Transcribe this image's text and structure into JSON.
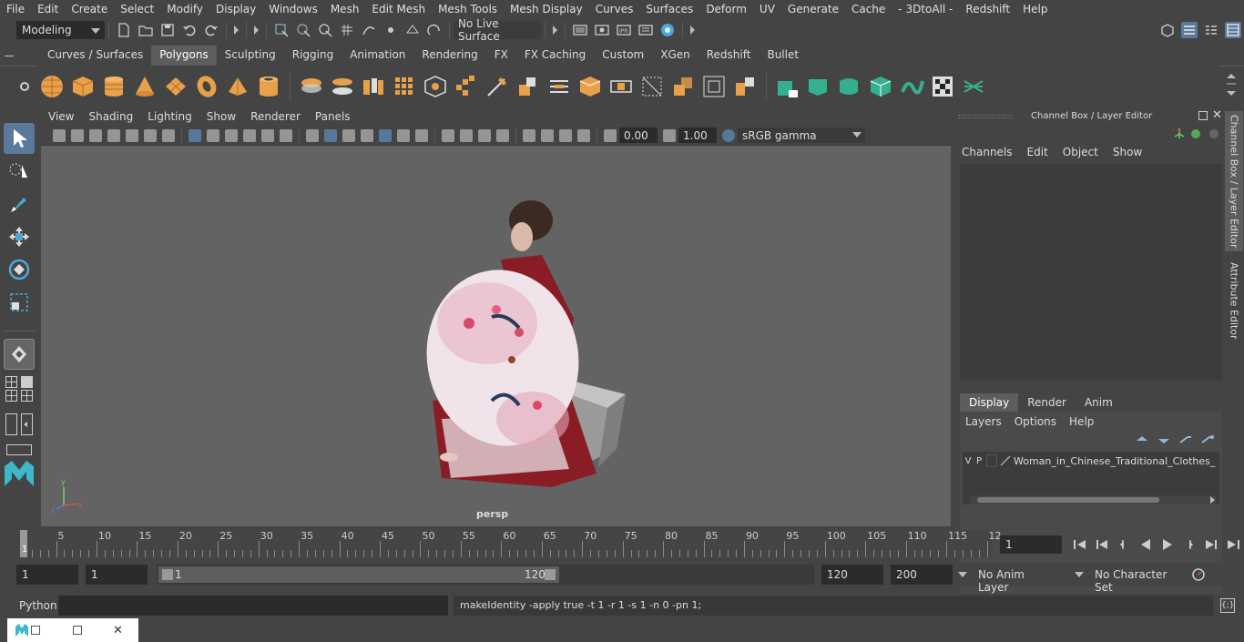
{
  "menubar": {
    "items": [
      "File",
      "Edit",
      "Create",
      "Select",
      "Modify",
      "Display",
      "Windows",
      "Mesh",
      "Edit Mesh",
      "Mesh Tools",
      "Mesh Display",
      "Curves",
      "Surfaces",
      "Deform",
      "UV",
      "Generate",
      "Cache",
      "- 3DtoAll -",
      "Redshift",
      "Help"
    ]
  },
  "statusline": {
    "workspace": "Modeling",
    "live_surface": "No Live Surface"
  },
  "shelf": {
    "tabs": [
      "Curves / Surfaces",
      "Polygons",
      "Sculpting",
      "Rigging",
      "Animation",
      "Rendering",
      "FX",
      "FX Caching",
      "Custom",
      "XGen",
      "Redshift",
      "Bullet"
    ],
    "active_tab": "Polygons",
    "icons": [
      "sphere-icon",
      "cube-icon",
      "cylinder-icon",
      "cone-icon",
      "plane-icon",
      "torus-icon",
      "pyramid-icon",
      "pipe-icon",
      "combine-icon",
      "separate-icon",
      "extract-icon",
      "smooth-icon",
      "booleans-icon",
      "mirror-icon",
      "grid-icon",
      "extrude-icon",
      "bevel-icon",
      "bridge-icon",
      "multicut-icon",
      "merge-icon",
      "fill-hole-icon",
      "insert-edge-loop-icon",
      "quad-draw-icon",
      "target-weld-icon",
      "uv-planar-icon",
      "uv-cylindrical-icon",
      "uv-spherical-icon",
      "uv-automatic-icon",
      "uv-unfold-icon",
      "uv-layout-icon",
      "uv-editor-icon"
    ]
  },
  "panel": {
    "menus": [
      "View",
      "Shading",
      "Lighting",
      "Show",
      "Renderer",
      "Panels"
    ],
    "exposure": "0.00",
    "gamma": "1.00",
    "color_space": "sRGB gamma",
    "camera_label": "persp"
  },
  "channel_box": {
    "title": "Channel Box / Layer Editor",
    "menus": [
      "Channels",
      "Edit",
      "Object",
      "Show"
    ],
    "layer_tabs": [
      "Display",
      "Render",
      "Anim"
    ],
    "active_layer_tab": "Display",
    "layer_menus": [
      "Layers",
      "Options",
      "Help"
    ],
    "layers": [
      {
        "v": "V",
        "p": "P",
        "name": "Woman_in_Chinese_Traditional_Clothes_Sit"
      }
    ]
  },
  "side_tabs": [
    "Channel Box / Layer Editor",
    "Attribute Editor"
  ],
  "timeline": {
    "ticks": [
      "5",
      "10",
      "15",
      "20",
      "25",
      "30",
      "35",
      "40",
      "45",
      "50",
      "55",
      "60",
      "65",
      "70",
      "75",
      "80",
      "85",
      "90",
      "95",
      "100",
      "105",
      "110",
      "115",
      "12"
    ],
    "start_label": "1",
    "current_frame": "1"
  },
  "range": {
    "start": "1",
    "playback_start": "1",
    "slider_start": "1",
    "slider_end": "120",
    "playback_end": "120",
    "end": "200",
    "anim_layer": "No Anim Layer",
    "character_set": "No Character Set"
  },
  "cmdline": {
    "language": "Python",
    "output": "makeIdentity -apply true -t 1 -r 1 -s 1 -n 0 -pn 1;"
  },
  "colors": {
    "shelf_orange": "#e8a04a",
    "shelf_teal": "#35b08e",
    "active_blue": "#5b7a9b",
    "viewport_bg": "#636363"
  }
}
